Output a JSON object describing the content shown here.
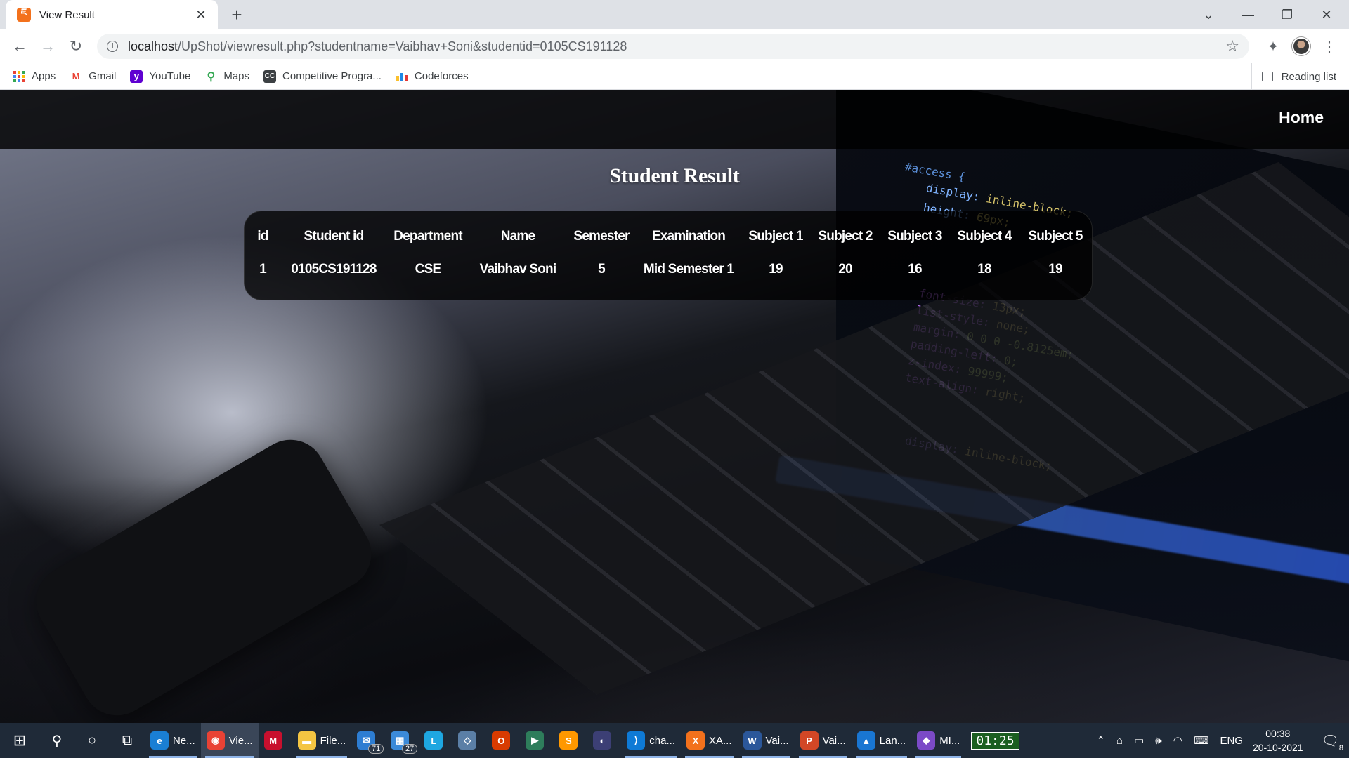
{
  "browser": {
    "tab_title": "View Result",
    "url_host": "localhost",
    "url_path": "/UpShot/viewresult.php?studentname=Vaibhav+Soni&studentid=0105CS191128",
    "bookmarks": [
      "Apps",
      "Gmail",
      "YouTube",
      "Maps",
      "Competitive Progra...",
      "Codeforces"
    ],
    "reading_list": "Reading list"
  },
  "site": {
    "nav_home": "Home",
    "title": "Student Result"
  },
  "table": {
    "headers": [
      "id",
      "Student id",
      "Department",
      "Name",
      "Semester",
      "Examination",
      "Subject 1",
      "Subject 2",
      "Subject 3",
      "Subject 4",
      "Subject 5"
    ],
    "rows": [
      [
        "1",
        "0105CS191128",
        "CSE",
        "Vaibhav Soni",
        "5",
        "Mid Semester 1",
        "19",
        "20",
        "16",
        "18",
        "19"
      ]
    ]
  },
  "taskbar": {
    "apps": [
      {
        "label": "Ne...",
        "icon": "edge-icon",
        "color": "#1a7fd4"
      },
      {
        "label": "Vie...",
        "icon": "chrome-icon",
        "color": "#e94235",
        "active": true
      },
      {
        "label": "",
        "icon": "mcafee-icon",
        "color": "#c8102e"
      },
      {
        "label": "File...",
        "icon": "folder-icon",
        "color": "#f4c542"
      },
      {
        "label": "",
        "icon": "mail-icon",
        "color": "#2d7dd2",
        "badge": "71"
      },
      {
        "label": "",
        "icon": "calendar-icon",
        "color": "#3b8ad9",
        "badge": "27"
      },
      {
        "label": "",
        "icon": "l-app-icon",
        "color": "#1ea7e1"
      },
      {
        "label": "",
        "icon": "virtualbox-icon",
        "color": "#5b7fa6"
      },
      {
        "label": "",
        "icon": "office-icon",
        "color": "#d83b01"
      },
      {
        "label": "",
        "icon": "terminal-icon",
        "color": "#2e7d5b"
      },
      {
        "label": "",
        "icon": "sublime-icon",
        "color": "#ff9800"
      },
      {
        "label": "",
        "icon": "eclipse-icon",
        "color": "#3c3f75"
      },
      {
        "label": "cha...",
        "icon": "vscode-icon",
        "color": "#0e7ad6"
      },
      {
        "label": "XA...",
        "icon": "xampp-icon",
        "color": "#f3711c"
      },
      {
        "label": "Vai...",
        "icon": "word-icon",
        "color": "#2b579a"
      },
      {
        "label": "Vai...",
        "icon": "powerpoint-icon",
        "color": "#d24726"
      },
      {
        "label": "Lan...",
        "icon": "image-icon",
        "color": "#1976d2"
      },
      {
        "label": "MI...",
        "icon": "mi-icon",
        "color": "#7b4ac7"
      }
    ],
    "timer": "01:25",
    "lang": "ENG",
    "time": "00:38",
    "date": "20-10-2021",
    "notif_count": "8"
  },
  "colors": {
    "taskbar": "#1f2a38",
    "tab_favicon": "#f3711c"
  }
}
